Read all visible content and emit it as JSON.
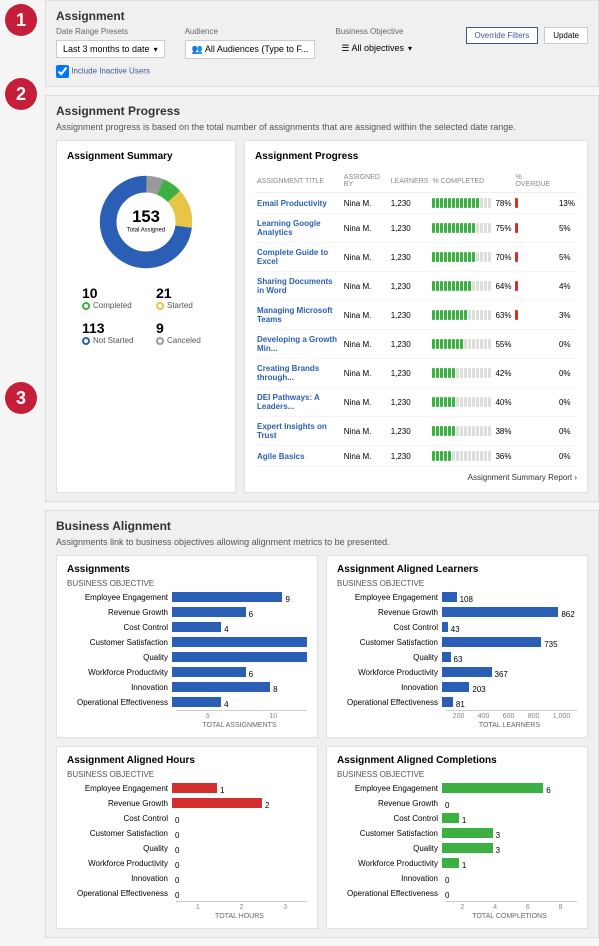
{
  "badges": [
    "1",
    "2",
    "3"
  ],
  "assignment": {
    "title": "Assignment",
    "filters": {
      "date_label": "Date Range Presets",
      "date_value": "Last 3 months to date",
      "audience_label": "Audience",
      "audience_value": "All Audiences (Type to F...",
      "objective_label": "Business Objective",
      "objective_value": "All objectives",
      "checkbox_label": "Include Inactive Users",
      "override_btn": "Override Filters",
      "update_btn": "Update"
    }
  },
  "progress": {
    "title": "Assignment Progress",
    "subtitle": "Assignment progress is based on the total number of assignments that are assigned within the selected date range.",
    "summary": {
      "title": "Assignment Summary",
      "total_n": "153",
      "total_t": "Total Assigned",
      "stats": [
        {
          "n": "10",
          "label": "Completed",
          "color": "#3cb043"
        },
        {
          "n": "21",
          "label": "Started",
          "color": "#e8c547"
        },
        {
          "n": "113",
          "label": "Not Started",
          "color": "#2a5fb5"
        },
        {
          "n": "9",
          "label": "Canceled",
          "color": "#999"
        }
      ],
      "donut_segments": [
        {
          "color": "#999",
          "pct": 6
        },
        {
          "color": "#3cb043",
          "pct": 7
        },
        {
          "color": "#e8c547",
          "pct": 14
        },
        {
          "color": "#2a5fb5",
          "pct": 73
        }
      ]
    },
    "table": {
      "title": "Assignment Progress",
      "headers": [
        "ASSIGNMENT TITLE",
        "ASSIGNED BY",
        "LEARNERS",
        "% COMPLETED",
        "",
        "% OVERDUE",
        ""
      ],
      "rows": [
        {
          "title": "Email Productivity",
          "by": "Nina M.",
          "learners": "1,230",
          "pct": 78,
          "od": 13
        },
        {
          "title": "Learning Google Analytics",
          "by": "Nina M.",
          "learners": "1,230",
          "pct": 75,
          "od": 5
        },
        {
          "title": "Complete Guide to Excel",
          "by": "Nina M.",
          "learners": "1,230",
          "pct": 70,
          "od": 5
        },
        {
          "title": "Sharing Documents in Word",
          "by": "Nina M.",
          "learners": "1,230",
          "pct": 64,
          "od": 4
        },
        {
          "title": "Managing Microsoft Teams",
          "by": "Nina M.",
          "learners": "1,230",
          "pct": 63,
          "od": 3
        },
        {
          "title": "Developing a Growth Min...",
          "by": "Nina M.",
          "learners": "1,230",
          "pct": 55,
          "od": 0
        },
        {
          "title": "Creating Brands through...",
          "by": "Nina M.",
          "learners": "1,230",
          "pct": 42,
          "od": 0
        },
        {
          "title": "DEI Pathways: A Leaders...",
          "by": "Nina M.",
          "learners": "1,230",
          "pct": 40,
          "od": 0
        },
        {
          "title": "Expert Insights on Trust",
          "by": "Nina M.",
          "learners": "1,230",
          "pct": 38,
          "od": 0
        },
        {
          "title": "Agile Basics",
          "by": "Nina M.",
          "learners": "1,230",
          "pct": 36,
          "od": 0
        }
      ],
      "report_link": "Assignment Summary Report  ›"
    }
  },
  "alignment": {
    "title": "Business Alignment",
    "subtitle": "Assignments link to business objectives allowing alignment metrics to be presented.",
    "charts": [
      {
        "title": "Assignments",
        "axis": "BUSINESS OBJECTIVE",
        "xlabel": "TOTAL ASSIGNMENTS",
        "color": "#2a5fb5",
        "max": 11,
        "ticks": [
          "5",
          "10"
        ],
        "data": [
          {
            "l": "Employee Engagement",
            "v": 9
          },
          {
            "l": "Revenue Growth",
            "v": 6
          },
          {
            "l": "Cost Control",
            "v": 4
          },
          {
            "l": "Customer Satisfaction",
            "v": 11
          },
          {
            "l": "Quality",
            "v": 11
          },
          {
            "l": "Workforce Productivity",
            "v": 6
          },
          {
            "l": "Innovation",
            "v": 8
          },
          {
            "l": "Operational Effectiveness",
            "v": 4
          }
        ]
      },
      {
        "title": "Assignment Aligned Learners",
        "axis": "BUSINESS OBJECTIVE",
        "xlabel": "TOTAL LEARNERS",
        "color": "#2a5fb5",
        "max": 1000,
        "ticks": [
          "200",
          "400",
          "600",
          "800",
          "1,000"
        ],
        "data": [
          {
            "l": "Employee Engagement",
            "v": 108
          },
          {
            "l": "Revenue Growth",
            "v": 862
          },
          {
            "l": "Cost Control",
            "v": 43
          },
          {
            "l": "Customer Satisfaction",
            "v": 735
          },
          {
            "l": "Quality",
            "v": 63
          },
          {
            "l": "Workforce Productivity",
            "v": 367
          },
          {
            "l": "Innovation",
            "v": 203
          },
          {
            "l": "Operational Effectiveness",
            "v": 81
          }
        ]
      },
      {
        "title": "Assignment Aligned Hours",
        "axis": "BUSINESS OBJECTIVE",
        "xlabel": "TOTAL HOURS",
        "color": "#d32f2f",
        "max": 3,
        "ticks": [
          "1",
          "2",
          "3"
        ],
        "data": [
          {
            "l": "Employee Engagement",
            "v": 1
          },
          {
            "l": "Revenue Growth",
            "v": 2
          },
          {
            "l": "Cost Control",
            "v": 0
          },
          {
            "l": "Customer Satisfaction",
            "v": 0
          },
          {
            "l": "Quality",
            "v": 0
          },
          {
            "l": "Workforce Productivity",
            "v": 0
          },
          {
            "l": "Innovation",
            "v": 0
          },
          {
            "l": "Operational Effectiveness",
            "v": 0
          }
        ]
      },
      {
        "title": "Assignment Aligned Completions",
        "axis": "BUSINESS OBJECTIVE",
        "xlabel": "TOTAL COMPLETIONS",
        "color": "#3cb043",
        "max": 8,
        "ticks": [
          "2",
          "4",
          "6",
          "8"
        ],
        "data": [
          {
            "l": "Employee Engagement",
            "v": 6
          },
          {
            "l": "Revenue Growth",
            "v": 0
          },
          {
            "l": "Cost Control",
            "v": 1
          },
          {
            "l": "Customer Satisfaction",
            "v": 3
          },
          {
            "l": "Quality",
            "v": 3
          },
          {
            "l": "Workforce Productivity",
            "v": 1
          },
          {
            "l": "Innovation",
            "v": 0
          },
          {
            "l": "Operational Effectiveness",
            "v": 0
          }
        ]
      }
    ]
  },
  "chart_data": [
    {
      "type": "bar",
      "title": "Assignments",
      "ylabel": "BUSINESS OBJECTIVE",
      "xlabel": "TOTAL ASSIGNMENTS",
      "categories": [
        "Employee Engagement",
        "Revenue Growth",
        "Cost Control",
        "Customer Satisfaction",
        "Quality",
        "Workforce Productivity",
        "Innovation",
        "Operational Effectiveness"
      ],
      "values": [
        9,
        6,
        4,
        11,
        11,
        6,
        8,
        4
      ],
      "xlim": [
        0,
        11
      ]
    },
    {
      "type": "bar",
      "title": "Assignment Aligned Learners",
      "ylabel": "BUSINESS OBJECTIVE",
      "xlabel": "TOTAL LEARNERS",
      "categories": [
        "Employee Engagement",
        "Revenue Growth",
        "Cost Control",
        "Customer Satisfaction",
        "Quality",
        "Workforce Productivity",
        "Innovation",
        "Operational Effectiveness"
      ],
      "values": [
        108,
        862,
        43,
        735,
        63,
        367,
        203,
        81
      ],
      "xlim": [
        0,
        1000
      ]
    },
    {
      "type": "bar",
      "title": "Assignment Aligned Hours",
      "ylabel": "BUSINESS OBJECTIVE",
      "xlabel": "TOTAL HOURS",
      "categories": [
        "Employee Engagement",
        "Revenue Growth",
        "Cost Control",
        "Customer Satisfaction",
        "Quality",
        "Workforce Productivity",
        "Innovation",
        "Operational Effectiveness"
      ],
      "values": [
        1,
        2,
        0,
        0,
        0,
        0,
        0,
        0
      ],
      "xlim": [
        0,
        3
      ]
    },
    {
      "type": "bar",
      "title": "Assignment Aligned Completions",
      "ylabel": "BUSINESS OBJECTIVE",
      "xlabel": "TOTAL COMPLETIONS",
      "categories": [
        "Employee Engagement",
        "Revenue Growth",
        "Cost Control",
        "Customer Satisfaction",
        "Quality",
        "Workforce Productivity",
        "Innovation",
        "Operational Effectiveness"
      ],
      "values": [
        6,
        0,
        1,
        3,
        3,
        1,
        0,
        0
      ],
      "xlim": [
        0,
        8
      ]
    },
    {
      "type": "pie",
      "title": "Assignment Summary",
      "categories": [
        "Completed",
        "Started",
        "Not Started",
        "Canceled"
      ],
      "values": [
        10,
        21,
        113,
        9
      ]
    }
  ]
}
